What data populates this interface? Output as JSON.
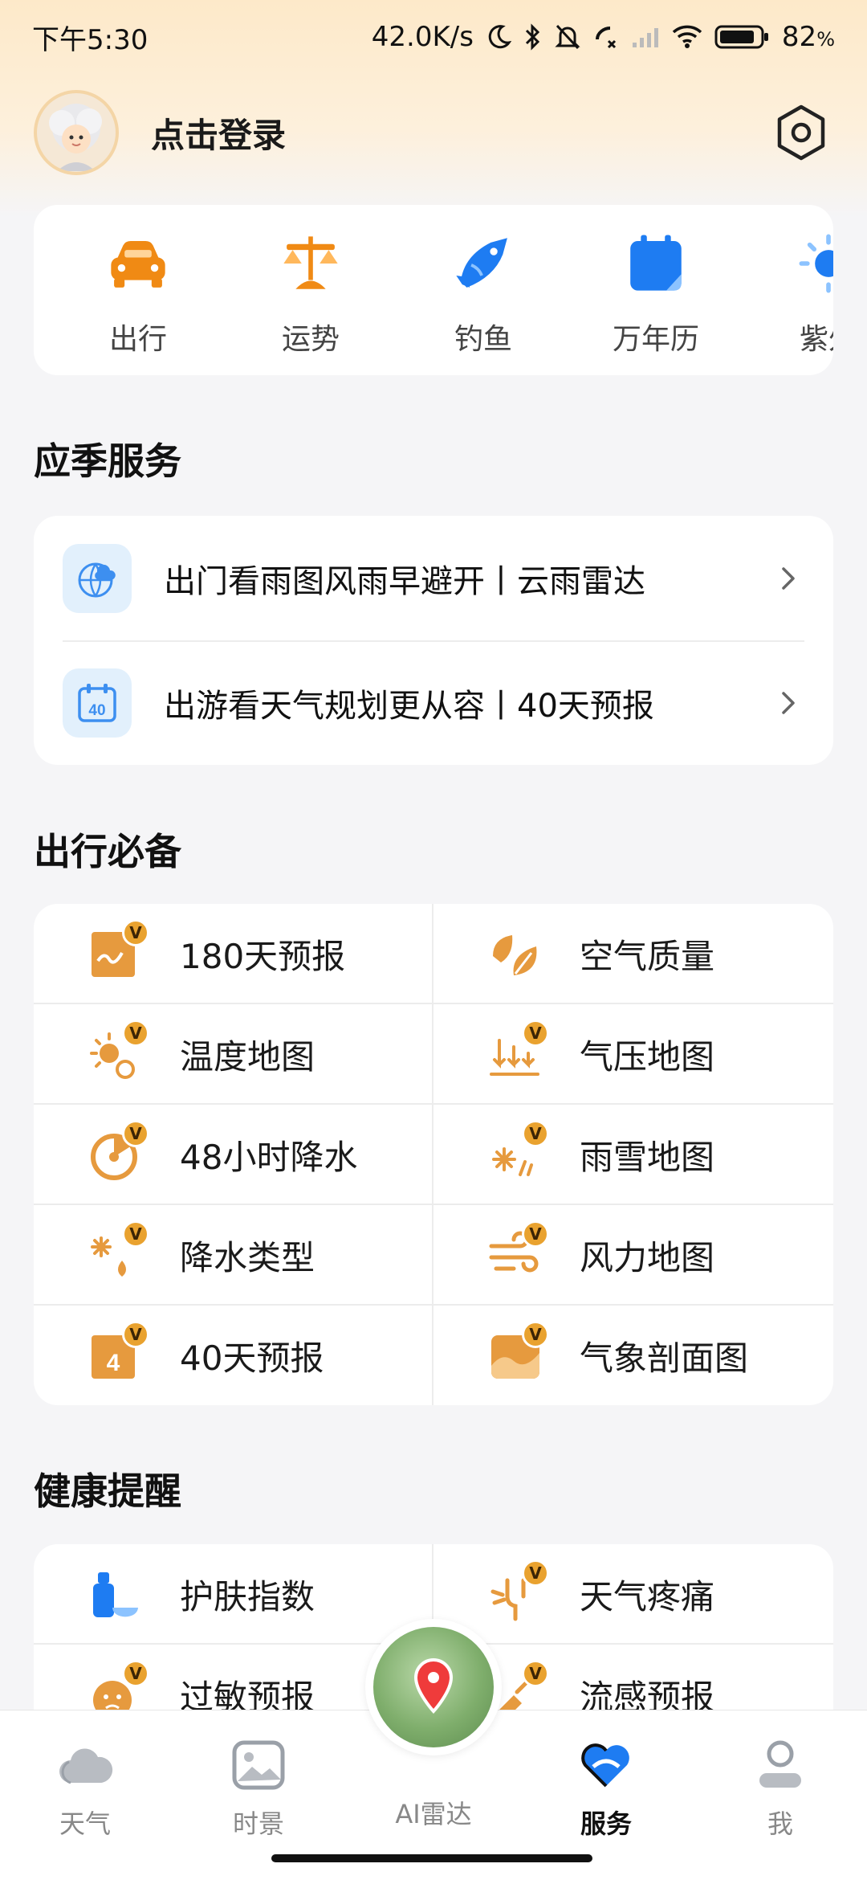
{
  "status_bar": {
    "time": "下午5:30",
    "net_speed": "42.0K/s",
    "battery": "82"
  },
  "header": {
    "login_text": "点击登录"
  },
  "quick_links": [
    {
      "label": "出行",
      "icon": "car-icon"
    },
    {
      "label": "运势",
      "icon": "fortune-icon"
    },
    {
      "label": "钓鱼",
      "icon": "fishing-icon"
    },
    {
      "label": "万年历",
      "icon": "calendar-icon"
    },
    {
      "label": "紫外",
      "icon": "uv-icon"
    }
  ],
  "sections": {
    "seasonal": "应季服务",
    "travel": "出行必备",
    "health": "健康提醒"
  },
  "seasonal_items": [
    {
      "text": "出门看雨图风雨早避开丨云雨雷达",
      "icon": "cloud-rain-globe-icon"
    },
    {
      "text": "出游看天气规划更从容丨40天预报",
      "icon": "calendar-40-icon"
    }
  ],
  "travel_grid": [
    {
      "label": "180天预报",
      "icon": "forecast-180-icon"
    },
    {
      "label": "空气质量",
      "icon": "air-quality-icon"
    },
    {
      "label": "温度地图",
      "icon": "temperature-map-icon"
    },
    {
      "label": "气压地图",
      "icon": "pressure-map-icon"
    },
    {
      "label": "48小时降水",
      "icon": "precipitation-48h-icon"
    },
    {
      "label": "雨雪地图",
      "icon": "rain-snow-map-icon"
    },
    {
      "label": "降水类型",
      "icon": "precipitation-type-icon"
    },
    {
      "label": "风力地图",
      "icon": "wind-map-icon"
    },
    {
      "label": "40天预报",
      "icon": "forecast-40-icon"
    },
    {
      "label": "气象剖面图",
      "icon": "weather-profile-icon"
    }
  ],
  "health_grid": [
    {
      "label": "护肤指数",
      "icon": "skincare-icon"
    },
    {
      "label": "天气疼痛",
      "icon": "weather-pain-icon"
    },
    {
      "label": "过敏预报",
      "icon": "allergy-icon"
    },
    {
      "label": "流感预报",
      "icon": "flu-icon"
    }
  ],
  "vip_badge": "V",
  "bottom_nav": [
    {
      "label": "天气",
      "icon": "cloud-icon"
    },
    {
      "label": "时景",
      "icon": "picture-icon"
    },
    {
      "label": "AI雷达",
      "icon": "radar-icon"
    },
    {
      "label": "服务",
      "icon": "service-heart-icon"
    },
    {
      "label": "我",
      "icon": "profile-icon"
    }
  ],
  "colors": {
    "accent_orange": "#f08a14",
    "accent_blue": "#1e7cf2",
    "vip_gold": "#e9a22f",
    "icon_brown": "#e69a3e"
  }
}
